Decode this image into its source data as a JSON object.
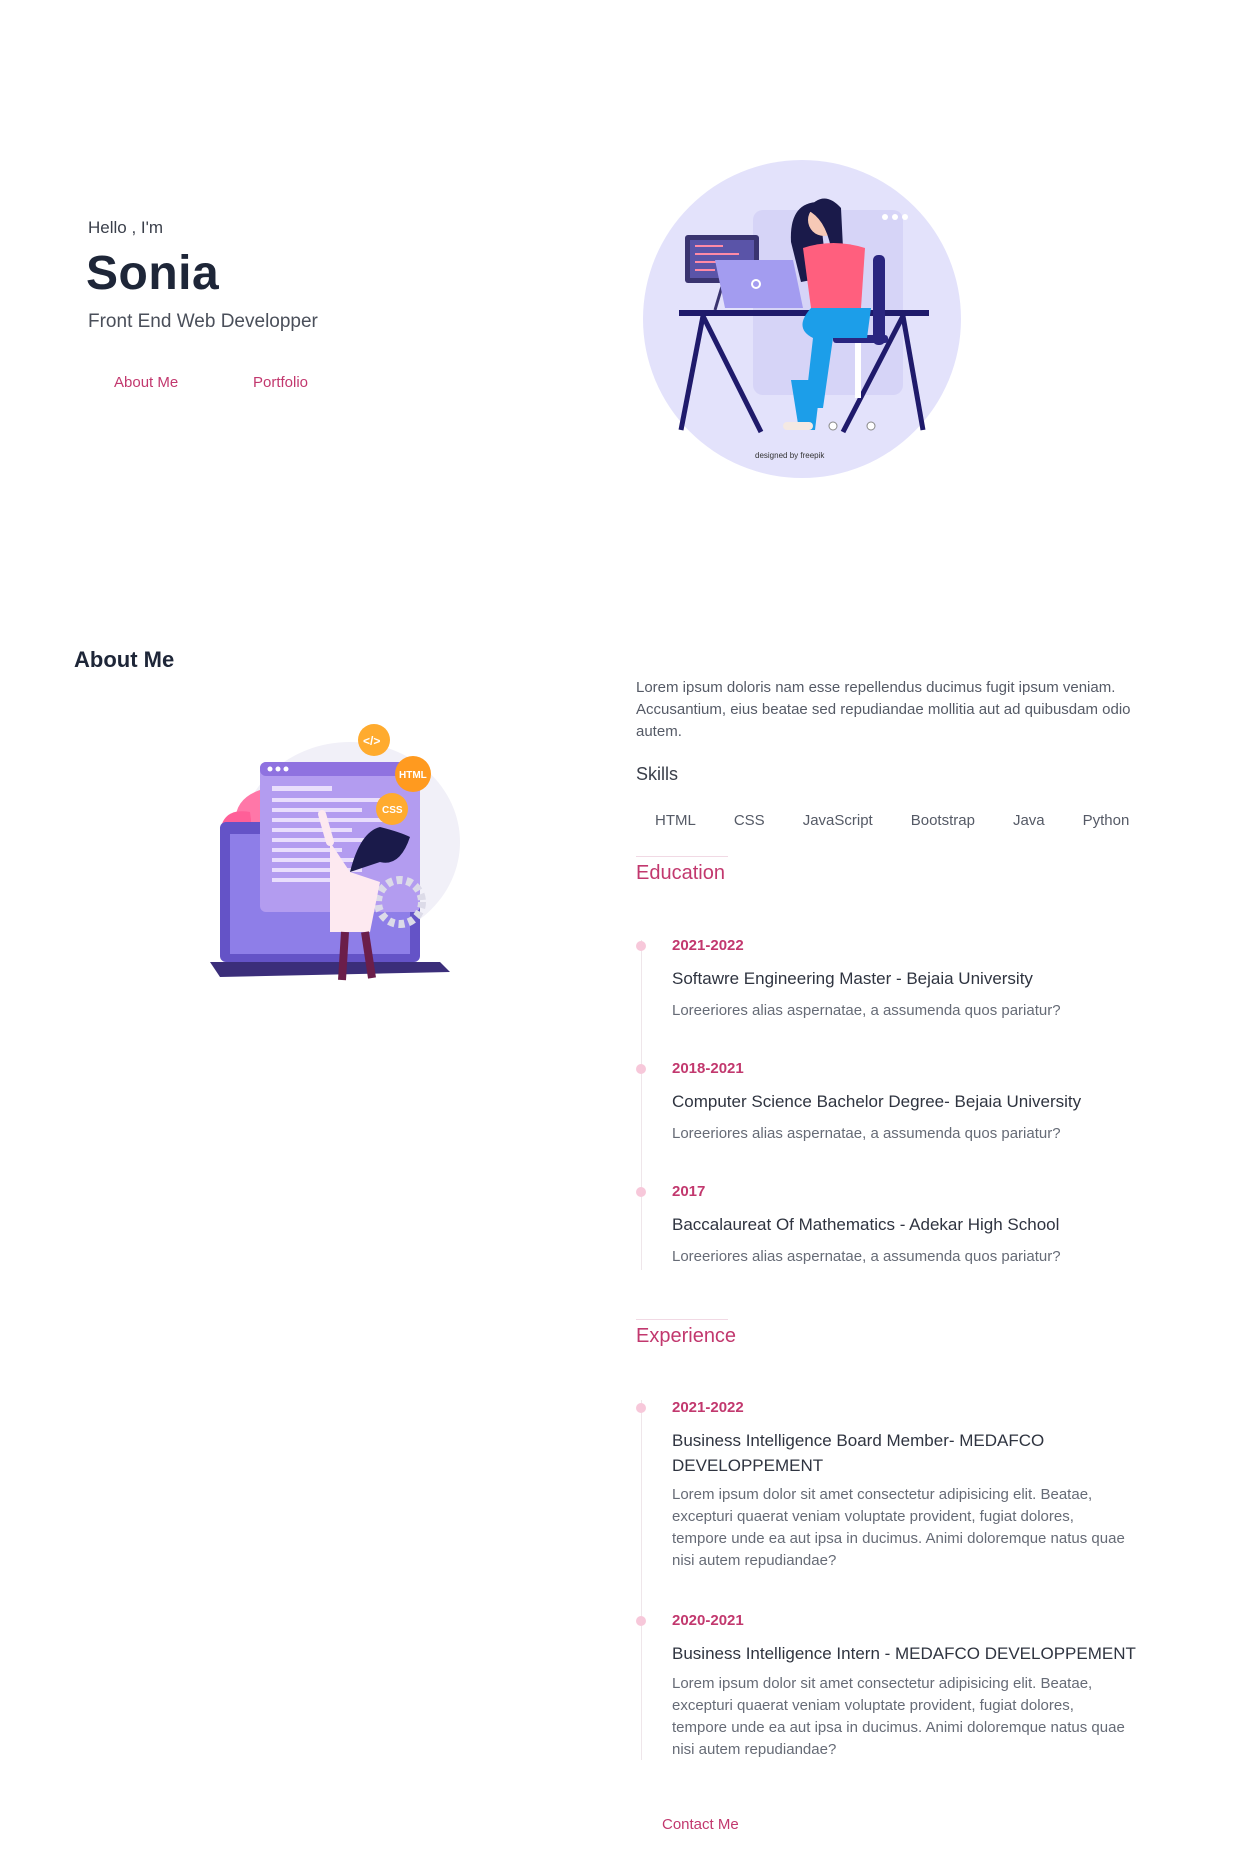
{
  "hero": {
    "greeting": "Hello , I'm",
    "name": "Sonia",
    "role": "Front End Web Developper",
    "about_btn": "About Me",
    "portfolio_btn": "Portfolio",
    "illustration_credit": "designed by freepik"
  },
  "about": {
    "title": "About Me",
    "intro": "Lorem ipsum doloris nam esse repellendus ducimus fugit ipsum veniam. Accusantium, eius beatae sed repudiandae mollitia aut ad quibusdam odio autem.",
    "skills_title": "Skills",
    "skills": [
      "HTML",
      "CSS",
      "JavaScript",
      "Bootstrap",
      "Java",
      "Python"
    ],
    "illustration_badges": [
      "</>",
      "HTML",
      "CSS"
    ]
  },
  "education": {
    "title": "Education",
    "items": [
      {
        "year": "2021-2022",
        "title": "Softawre Engineering Master - Bejaia University",
        "desc": "Loreeriores alias aspernatae, a assumenda quos pariatur?"
      },
      {
        "year": "2018-2021",
        "title": "Computer Science Bachelor Degree- Bejaia University",
        "desc": "Loreeriores alias aspernatae, a assumenda quos pariatur?"
      },
      {
        "year": "2017",
        "title": "Baccalaureat Of Mathematics - Adekar High School",
        "desc": "Loreeriores alias aspernatae, a assumenda quos pariatur?"
      }
    ]
  },
  "experience": {
    "title": "Experience",
    "items": [
      {
        "year": "2021-2022",
        "title": "Business Intelligence Board Member- MEDAFCO DEVELOPPEMENT",
        "desc": "Lorem ipsum dolor sit amet consectetur adipisicing elit. Beatae, excepturi quaerat veniam voluptate provident, fugiat dolores, tempore unde ea aut ipsa in ducimus. Animi doloremque natus quae nisi autem repudiandae?"
      },
      {
        "year": "2020-2021",
        "title": "Business Intelligence Intern - MEDAFCO DEVELOPPEMENT",
        "desc": "Lorem ipsum dolor sit amet consectetur adipisicing elit. Beatae, excepturi quaerat veniam voluptate provident, fugiat dolores, tempore unde ea aut ipsa in ducimus. Animi doloremque natus quae nisi autem repudiandae?"
      }
    ]
  },
  "footer": {
    "contact": "Contact Me"
  },
  "colors": {
    "accent": "#c2386e",
    "heading": "#1e2638",
    "timeline_dot": "#f7c8da"
  }
}
